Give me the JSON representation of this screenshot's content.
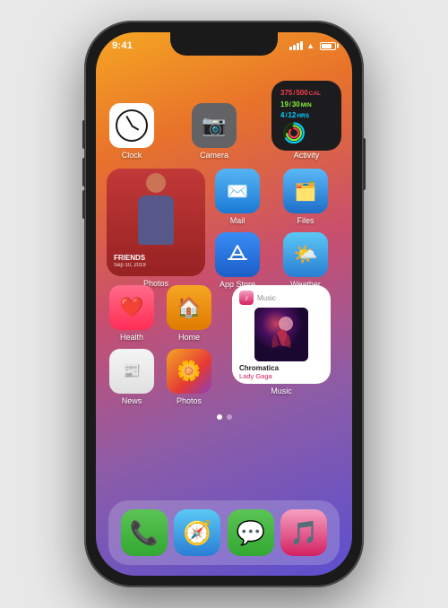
{
  "phone": {
    "status": {
      "time": "9:41",
      "signal_bars": [
        3,
        5,
        7,
        9,
        11
      ],
      "battery_level": "70%"
    },
    "row1": {
      "apps": [
        {
          "id": "clock",
          "label": "Clock",
          "icon_type": "clock"
        },
        {
          "id": "camera",
          "label": "Camera",
          "icon_type": "camera"
        },
        {
          "id": "activity",
          "label": "Activity",
          "icon_type": "activity"
        }
      ],
      "activity": {
        "cal_current": "375",
        "cal_total": "500",
        "cal_unit": "CAL",
        "move_current": "19",
        "move_total": "30",
        "move_unit": "MIN",
        "stand_current": "4",
        "stand_total": "12",
        "stand_unit": "HRS"
      }
    },
    "row2": {
      "photos_widget": {
        "label": "Photos",
        "person_label": "FRIENDS",
        "date": "Sep 10, 2019"
      },
      "small_apps": [
        {
          "id": "mail",
          "label": "Mail",
          "icon_type": "mail"
        },
        {
          "id": "files",
          "label": "Files",
          "icon_type": "files"
        },
        {
          "id": "appstore",
          "label": "App Store",
          "icon_type": "appstore"
        },
        {
          "id": "weather",
          "label": "Weather",
          "icon_type": "weather"
        }
      ]
    },
    "row3": {
      "small_apps_left": [
        {
          "id": "health",
          "label": "Health",
          "icon_type": "health"
        },
        {
          "id": "home",
          "label": "Home",
          "icon_type": "home"
        }
      ],
      "small_apps_left2": [
        {
          "id": "news",
          "label": "News",
          "icon_type": "news"
        },
        {
          "id": "photos-small",
          "label": "Photos",
          "icon_type": "photos-small"
        }
      ],
      "music_widget": {
        "label": "Music",
        "album_title": "Chromatica",
        "artist": "Lady Gaga",
        "icon_type": "music"
      }
    },
    "dock": {
      "apps": [
        {
          "id": "phone",
          "label": "",
          "icon_type": "phone"
        },
        {
          "id": "safari",
          "label": "",
          "icon_type": "safari"
        },
        {
          "id": "messages",
          "label": "",
          "icon_type": "messages"
        },
        {
          "id": "music",
          "label": "",
          "icon_type": "music-app"
        }
      ]
    }
  }
}
